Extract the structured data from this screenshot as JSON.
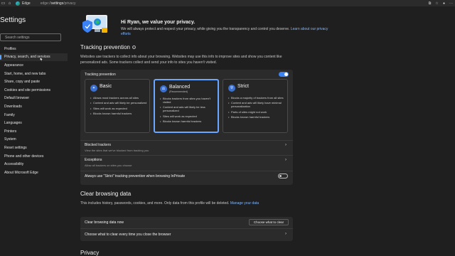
{
  "titlebar": {
    "app_name": "Edge",
    "url_prefix": "edge://",
    "url_host": "settings",
    "url_path": "/privacy"
  },
  "sidebar": {
    "title": "Settings",
    "search_placeholder": "Search settings",
    "items": [
      {
        "label": "Profiles"
      },
      {
        "label": "Privacy, search, and services"
      },
      {
        "label": "Appearance"
      },
      {
        "label": "Start, home, and new tabs"
      },
      {
        "label": "Share, copy and paste"
      },
      {
        "label": "Cookies and site permissions"
      },
      {
        "label": "Default browser"
      },
      {
        "label": "Downloads"
      },
      {
        "label": "Family"
      },
      {
        "label": "Languages"
      },
      {
        "label": "Printers"
      },
      {
        "label": "System"
      },
      {
        "label": "Reset settings"
      },
      {
        "label": "Phone and other devices"
      },
      {
        "label": "Accessibility"
      },
      {
        "label": "About Microsoft Edge"
      }
    ]
  },
  "banner": {
    "heading": "Hi Ryan, we value your privacy.",
    "body": "We will always protect and respect your privacy, while giving you the transparency and control you deserve.",
    "link": "Learn about our privacy efforts"
  },
  "tracking": {
    "title": "Tracking prevention",
    "description": "Websites use trackers to collect info about your browsing. Websites may use this info to improve sites and show you content like personalized ads. Some trackers collect and send your info to sites you haven't visited.",
    "toggle_label": "Tracking prevention",
    "options": [
      {
        "title": "Basic",
        "subtitle": "",
        "bullets": [
          "Allows most trackers across all sites",
          "Content and ads will likely be personalized",
          "Sites will work as expected",
          "Blocks known harmful trackers"
        ]
      },
      {
        "title": "Balanced",
        "subtitle": "(Recommended)",
        "bullets": [
          "Blocks trackers from sites you haven't visited",
          "Content and ads will likely be less personalized",
          "Sites will work as expected",
          "Blocks known harmful trackers"
        ]
      },
      {
        "title": "Strict",
        "subtitle": "",
        "bullets": [
          "Blocks a majority of trackers from all sites",
          "Content and ads will likely have minimal personalization",
          "Parts of sites might not work",
          "Blocks known harmful trackers"
        ]
      }
    ],
    "blocked_label": "Blocked trackers",
    "blocked_sub": "View the sites that we've blocked from tracking you",
    "exceptions_label": "Exceptions",
    "exceptions_sub": "Allow all trackers on sites you choose",
    "strict_inprivate_label": "Always use \"Strict\" tracking prevention when browsing InPrivate"
  },
  "clear": {
    "title": "Clear browsing data",
    "description": "This includes history, passwords, cookies, and more. Only data from this profile will be deleted.",
    "manage_link": "Manage your data",
    "now_label": "Clear browsing data now",
    "button_label": "Choose what to clear",
    "every_time_label": "Choose what to clear every time you close the browser"
  },
  "privacy": {
    "title": "Privacy"
  },
  "colors": {
    "accent": "#3b82f6",
    "link": "#7eb6ff",
    "background": "#1f1f1f",
    "card": "#2b2b2b"
  }
}
